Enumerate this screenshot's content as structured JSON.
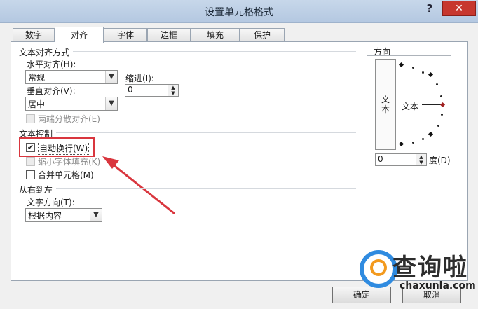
{
  "window": {
    "title": "设置单元格格式",
    "help": "?",
    "close": "✕"
  },
  "tabs": [
    {
      "label": "数字"
    },
    {
      "label": "对齐"
    },
    {
      "label": "字体"
    },
    {
      "label": "边框"
    },
    {
      "label": "填充"
    },
    {
      "label": "保护"
    }
  ],
  "text_alignment": {
    "section": "文本对齐方式",
    "horizontal_label": "水平对齐(H):",
    "horizontal_value": "常规",
    "indent_label": "缩进(I):",
    "indent_value": "0",
    "vertical_label": "垂直对齐(V):",
    "vertical_value": "居中",
    "distributed_label": "两端分散对齐(E)"
  },
  "text_control": {
    "section": "文本控制",
    "wrap_label": "自动换行(W)",
    "wrap_checked": true,
    "shrink_label": "缩小字体填充(K)",
    "merge_label": "合并单元格(M)"
  },
  "rtl": {
    "section": "从右到左",
    "direction_label": "文字方向(T):",
    "direction_value": "根据内容"
  },
  "orientation": {
    "section": "方向",
    "vertical_text": [
      "文",
      "本"
    ],
    "text": "文本",
    "degree_value": "0",
    "degree_label": "度(D)"
  },
  "buttons": {
    "ok": "确定",
    "cancel": "取消"
  },
  "watermark": {
    "text": "查询啦",
    "url": "chaxunla.com"
  },
  "colors": {
    "annotation": "#d9363e",
    "close": "#c7372e",
    "brand_blue": "#2f8be0",
    "brand_orange": "#f39a1e"
  }
}
